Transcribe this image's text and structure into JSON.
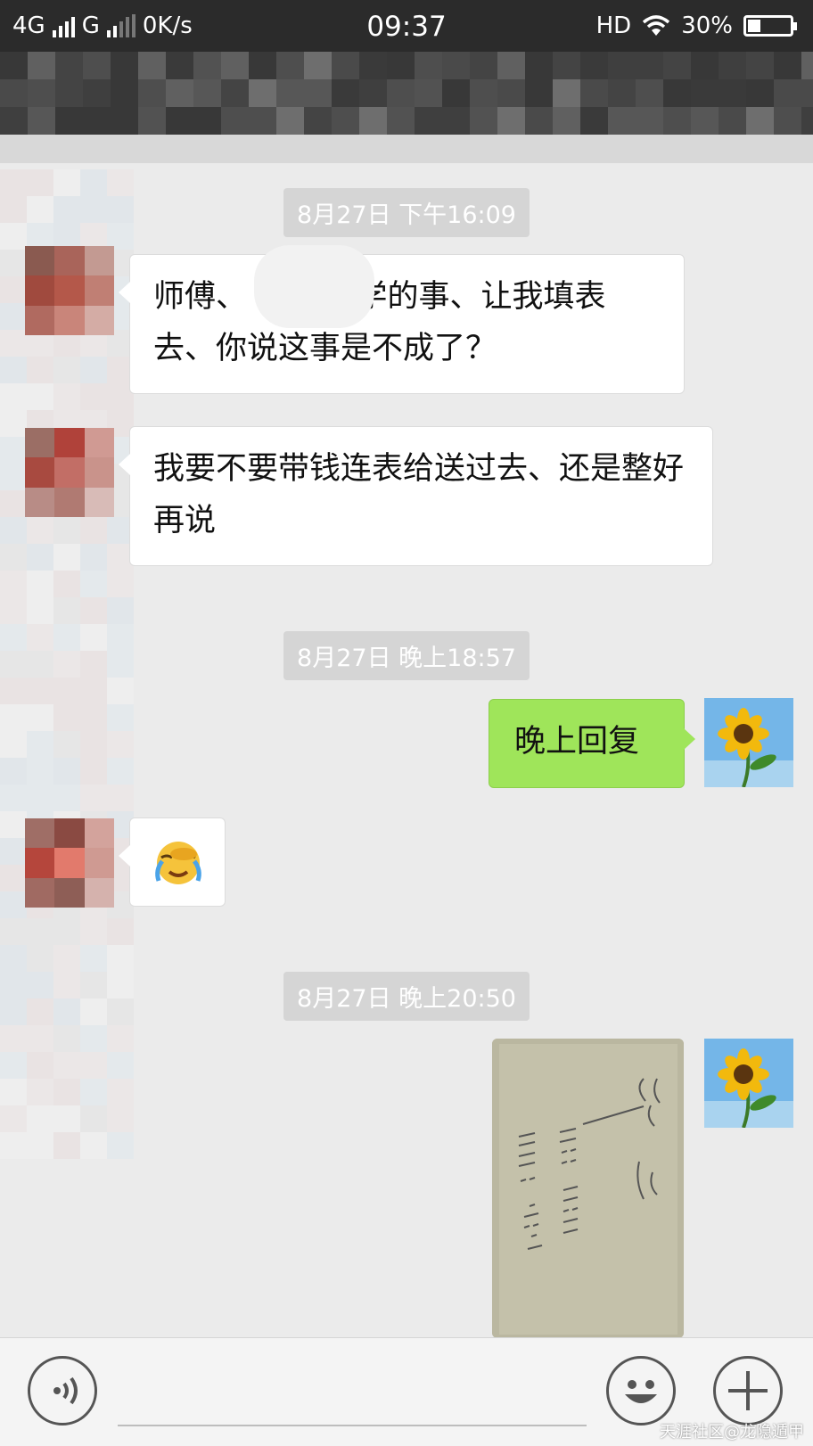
{
  "status_bar": {
    "network1": "4G",
    "network2": "G",
    "speed": "0K/s",
    "time": "09:37",
    "hd": "HD",
    "battery": "30%",
    "battery_level": 0.3
  },
  "messages": [
    {
      "type": "timestamp",
      "text": "8月27日 下午16:09"
    },
    {
      "type": "text",
      "side": "left",
      "text": "师傅、　　　上学的事、让我填表去、你说这事是不成了？"
    },
    {
      "type": "text",
      "side": "left",
      "text": "我要不要带钱连表给送过去、还是整好再说"
    },
    {
      "type": "timestamp",
      "text": "8月27日 晚上18:57"
    },
    {
      "type": "text",
      "side": "right",
      "text": "晚上回复"
    },
    {
      "type": "emoji",
      "side": "left",
      "icon": "crying-face-emoji"
    },
    {
      "type": "timestamp",
      "text": "8月27日 晚上20:50"
    },
    {
      "type": "image",
      "side": "right",
      "icon": "handwritten-note-photo"
    }
  ],
  "watermark": "天涯社区@龙隐遁甲",
  "colors": {
    "right_bubble": "#9fe55a",
    "chat_background": "#ebebeb",
    "status_bar": "#2b2b2b"
  }
}
